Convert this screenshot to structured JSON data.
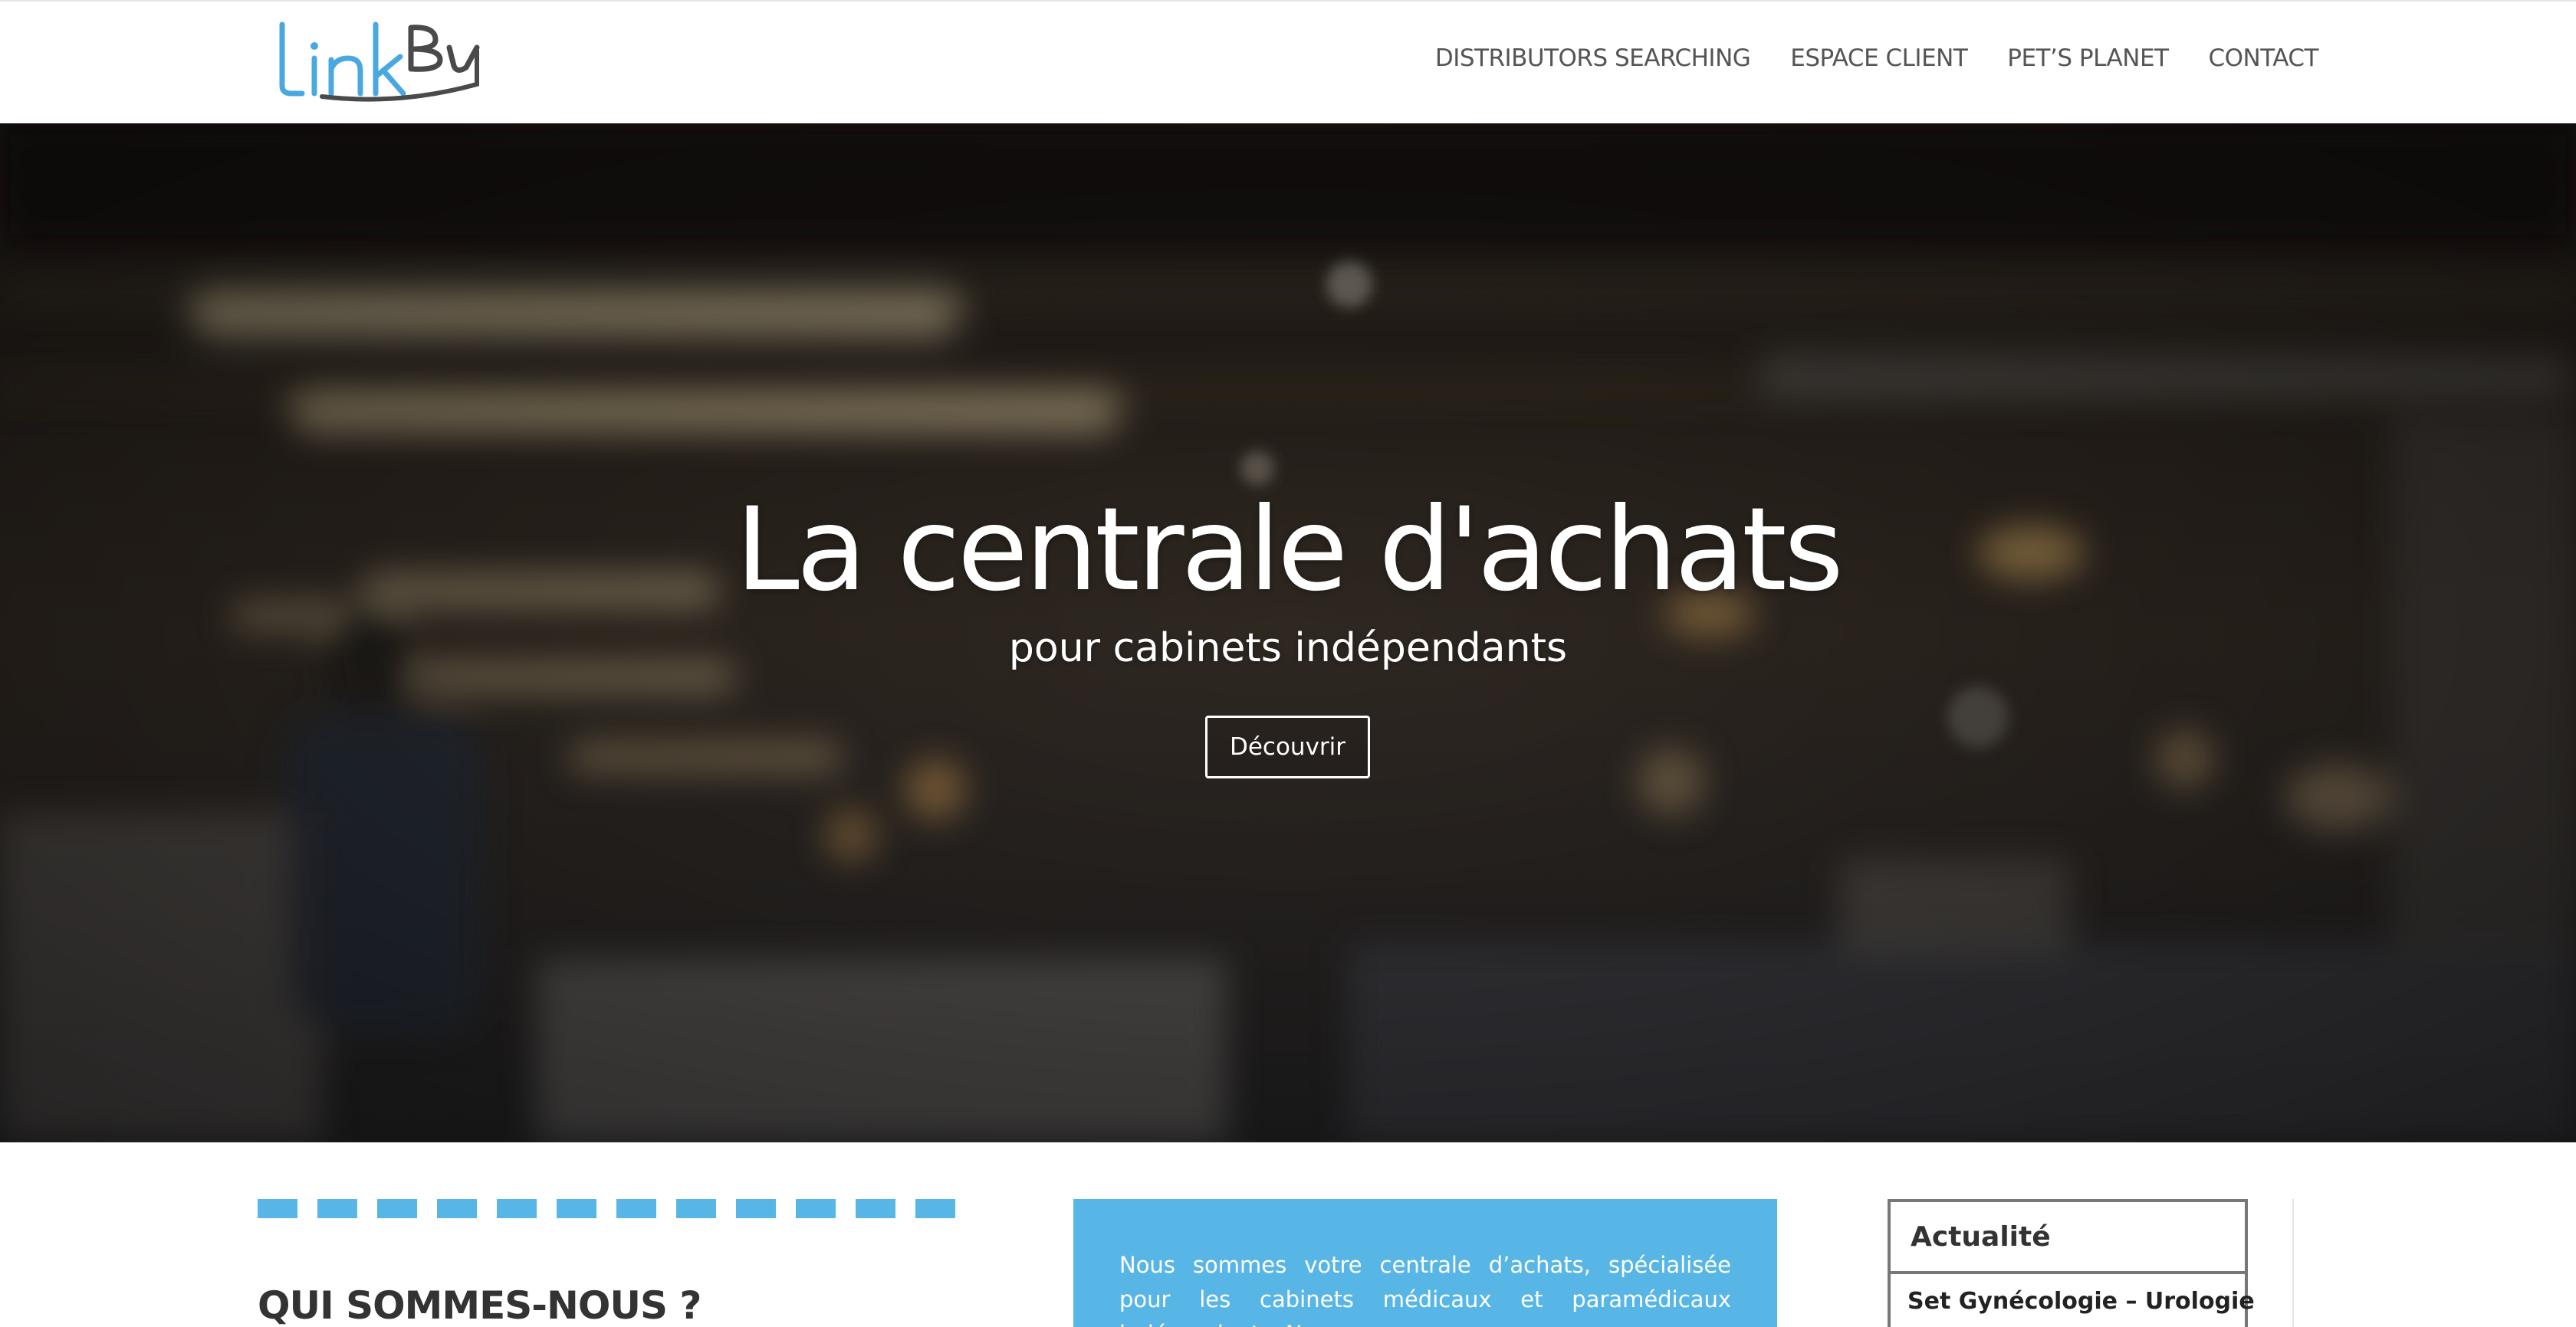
{
  "header": {
    "logo_text": "LinkBy",
    "nav": [
      "DISTRIBUTORS SEARCHING",
      "ESPACE CLIENT",
      "PET’S PLANET",
      "CONTACT"
    ]
  },
  "hero": {
    "title": "La centrale d'achats",
    "subtitle": "pour cabinets indépendants",
    "button_label": "Découvrir"
  },
  "about": {
    "heading": "QUI SOMMES-NOUS ?",
    "intro": "Nous sommes votre centrale d’achats, spécialisée pour les cabinets médicaux et paramédicaux indépendants. Nous"
  },
  "news": {
    "title": "Actualité",
    "items": [
      "Set Gynécologie – Urologie"
    ]
  },
  "colors": {
    "accent": "#58b6e7",
    "logo_blue": "#4aa8e0",
    "logo_dark": "#4a4a4a",
    "nav_text": "#555555"
  }
}
